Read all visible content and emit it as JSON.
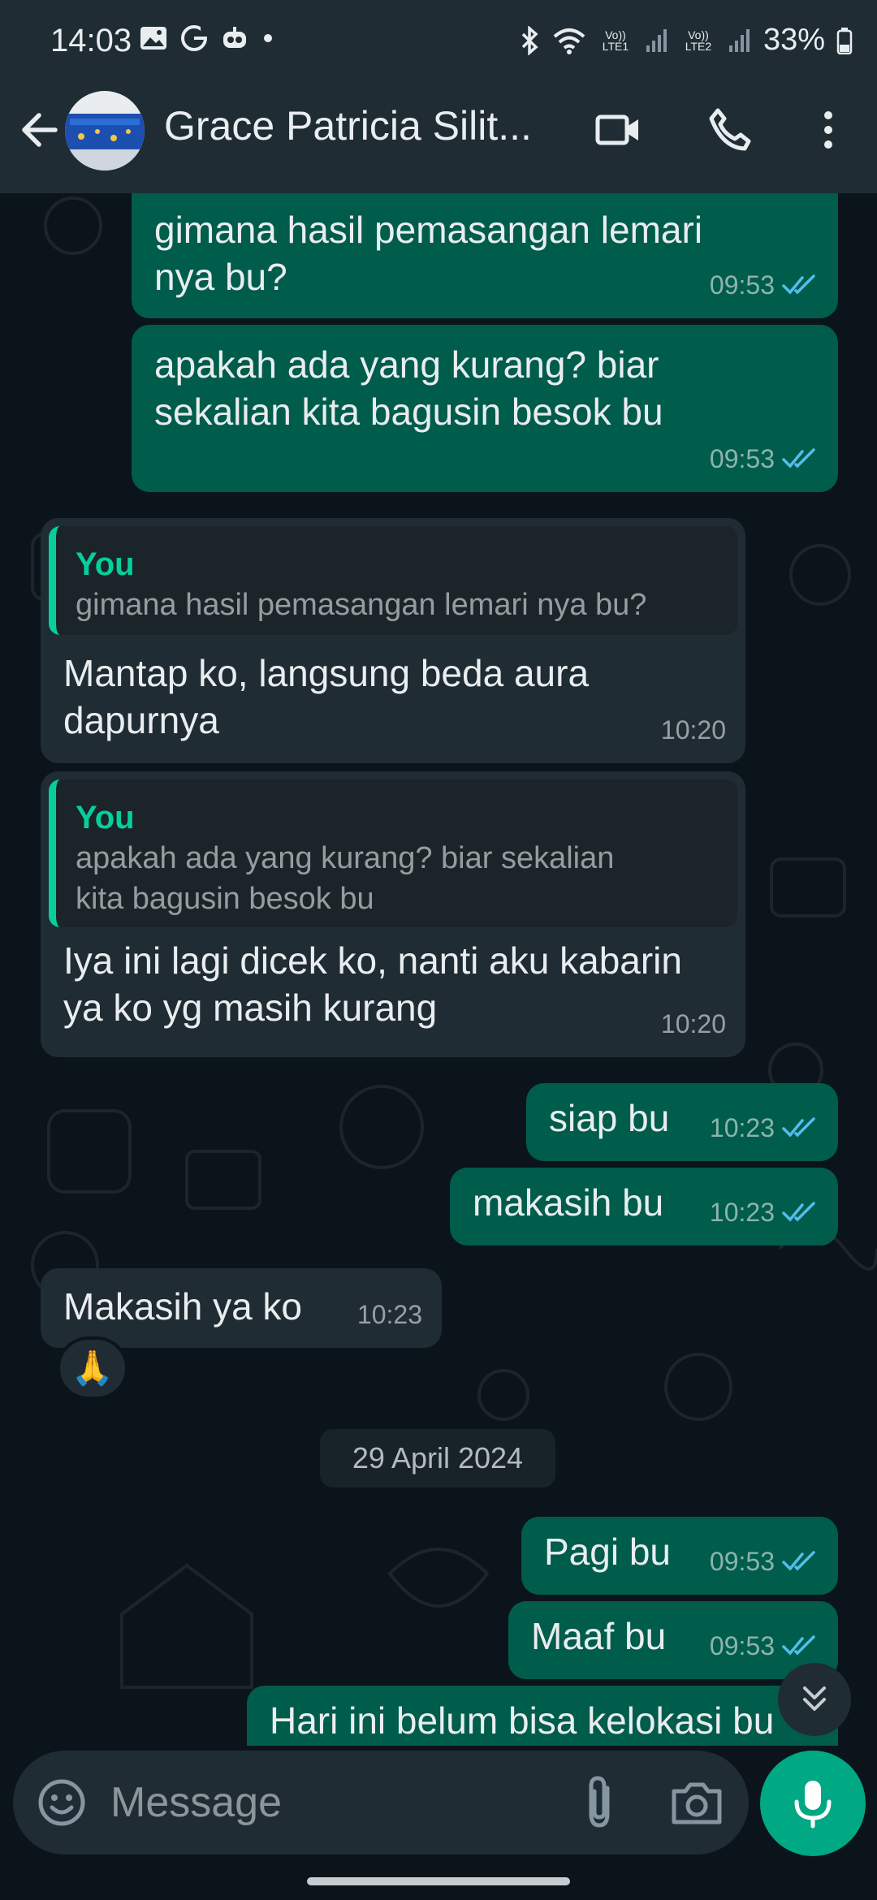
{
  "status_bar": {
    "time": "14:03",
    "battery": "33%",
    "sim1": "Vo)) LTE1",
    "sim2": "Vo)) LTE2",
    "left_icons": [
      "gallery-icon",
      "g-icon",
      "robot-icon",
      "dot-icon"
    ],
    "right_icons": [
      "bluetooth-icon",
      "wifi-icon",
      "signal-icon",
      "battery-icon"
    ]
  },
  "header": {
    "contact_name": "Grace Patricia Silit..."
  },
  "messages": [
    {
      "direction": "out",
      "text": "gimana hasil pemasangan lemari\nnya bu?",
      "time": "09:53",
      "status": "read"
    },
    {
      "direction": "out",
      "text": "apakah ada yang kurang? biar\nsekalian kita bagusin besok bu",
      "time": "09:53",
      "status": "read"
    },
    {
      "direction": "in",
      "quote_author": "You",
      "quote_text": "gimana hasil pemasangan lemari nya bu?",
      "text": "Mantap ko, langsung beda aura\ndapurnya",
      "time": "10:20"
    },
    {
      "direction": "in",
      "quote_author": "You",
      "quote_text": "apakah ada yang kurang? biar sekalian\nkita bagusin besok bu",
      "text": "Iya ini lagi dicek ko, nanti aku kabarin\nya ko yg masih kurang",
      "time": "10:20"
    },
    {
      "direction": "out",
      "text": "siap bu",
      "time": "10:23",
      "status": "read"
    },
    {
      "direction": "out",
      "text": "makasih bu",
      "time": "10:23",
      "status": "read"
    },
    {
      "direction": "in",
      "text": "Makasih ya ko",
      "time": "10:23",
      "reaction": "🙏"
    },
    {
      "direction": "out",
      "text": "Pagi bu",
      "time": "09:53",
      "status": "read"
    },
    {
      "direction": "out",
      "text": "Maaf bu",
      "time": "09:53",
      "status": "read"
    },
    {
      "direction": "out",
      "text": "Hari ini belum bisa kelokasi bu",
      "time": "",
      "status": ""
    }
  ],
  "date_separator": "29 April 2024",
  "input": {
    "placeholder": "Message"
  },
  "colors": {
    "background": "#0b141a",
    "header": "#1f2c34",
    "outgoing_bubble": "#005c4b",
    "incoming_bubble": "#202c33",
    "accent": "#00a884",
    "quote_accent": "#06cf9c",
    "read_ticks": "#53bdeb"
  }
}
